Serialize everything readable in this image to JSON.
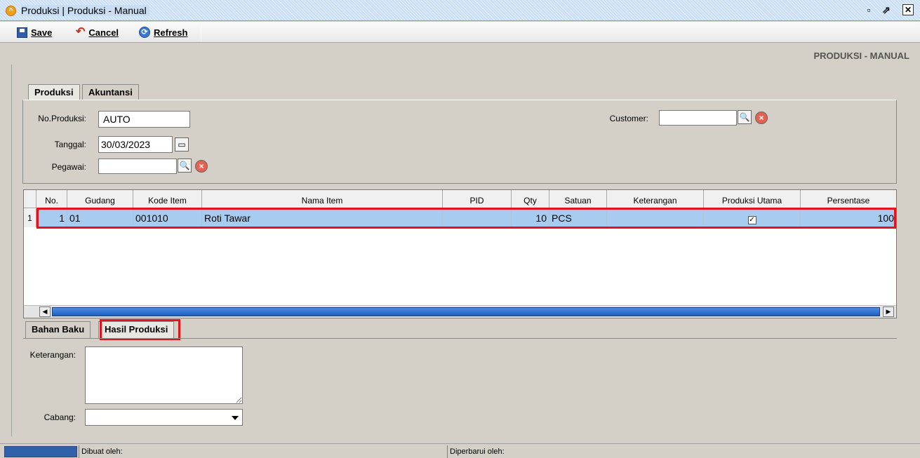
{
  "window": {
    "title": "Produksi | Produksi - Manual"
  },
  "toolbar": {
    "save_label": "Save",
    "cancel_label": "Cancel",
    "refresh_label": "Refresh"
  },
  "page_header": "PRODUKSI - MANUAL",
  "tabs": [
    "Produksi",
    "Akuntansi"
  ],
  "form": {
    "no_produksi_label": "No.Produksi:",
    "no_produksi_value": "AUTO",
    "tanggal_label": "Tanggal:",
    "tanggal_value": "30/03/2023",
    "pegawai_label": "Pegawai:",
    "pegawai_value": "",
    "customer_label": "Customer:",
    "customer_value": ""
  },
  "grid": {
    "columns": [
      "No.",
      "Gudang",
      "Kode Item",
      "Nama Item",
      "PID",
      "Qty",
      "Satuan",
      "Keterangan",
      "Produksi Utama",
      "Persentase"
    ],
    "row_number": "1",
    "rows": [
      {
        "no": "1",
        "gudang": "01",
        "kode_item": "001010",
        "nama_item": "Roti Tawar",
        "pid": "",
        "qty": "10",
        "satuan": "PCS",
        "keterangan": "",
        "produksi_utama": "✓",
        "persentase": "100"
      }
    ]
  },
  "bottom_tabs": [
    "Bahan Baku",
    "Hasil Produksi"
  ],
  "bottom_form": {
    "keterangan_label": "Keterangan:",
    "keterangan_value": "",
    "cabang_label": "Cabang:",
    "cabang_value": ""
  },
  "status": {
    "dibuat_label": "Dibuat oleh:",
    "diperbarui_label": "Diperbarui oleh:"
  },
  "colors": {
    "highlight": "#e0141e",
    "row_selected": "#a8cbf0"
  }
}
